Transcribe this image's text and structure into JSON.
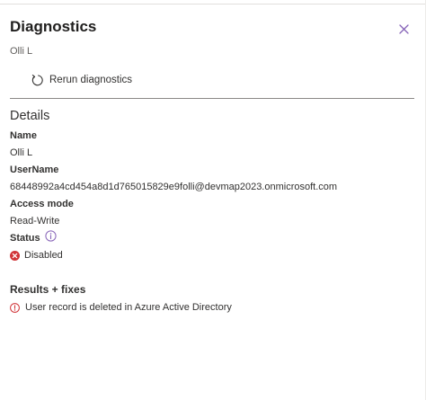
{
  "panel": {
    "title": "Diagnostics",
    "subtitle": "Olli L",
    "close_icon": "close-icon"
  },
  "actions": {
    "rerun_label": "Rerun diagnostics",
    "rerun_icon": "refresh-icon"
  },
  "details": {
    "heading": "Details",
    "fields": [
      {
        "label": "Name",
        "value": "Olli L"
      },
      {
        "label": "UserName",
        "value": "68448992a4cd454a8d1d765015829e9folli@devmap2023.onmicrosoft.com"
      },
      {
        "label": "Access mode",
        "value": "Read-Write"
      }
    ],
    "status": {
      "label": "Status",
      "info_icon": "info-icon",
      "value": "Disabled",
      "value_icon": "error-circle-icon",
      "value_color": "#d13438"
    }
  },
  "results": {
    "heading": "Results + fixes",
    "items": [
      {
        "icon": "warning-info-icon",
        "color": "#d13438",
        "text": "User record is deleted in Azure Active Directory"
      }
    ]
  },
  "colors": {
    "accent": "#8764b8",
    "error": "#d13438",
    "divider": "#8a8886"
  }
}
